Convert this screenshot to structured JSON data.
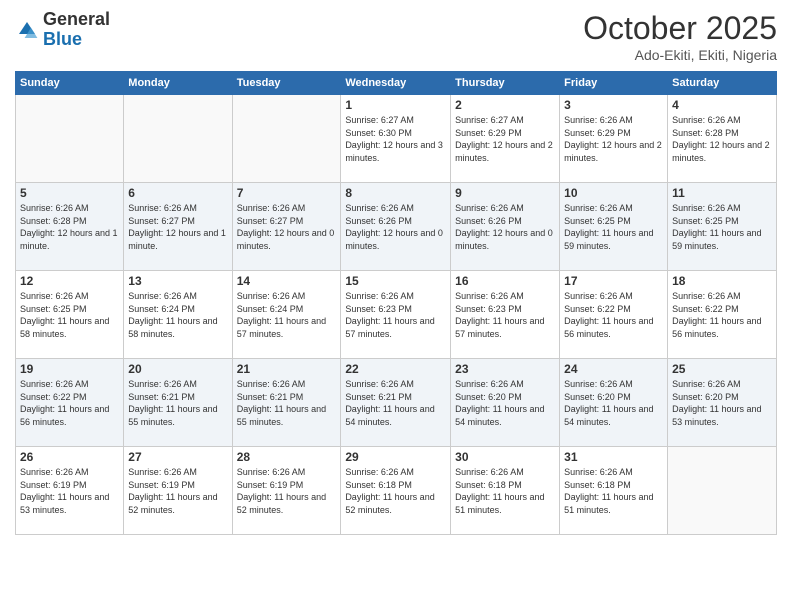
{
  "header": {
    "logo_general": "General",
    "logo_blue": "Blue",
    "month_title": "October 2025",
    "subtitle": "Ado-Ekiti, Ekiti, Nigeria"
  },
  "days_of_week": [
    "Sunday",
    "Monday",
    "Tuesday",
    "Wednesday",
    "Thursday",
    "Friday",
    "Saturday"
  ],
  "weeks": [
    [
      {
        "day": "",
        "sunrise": "",
        "sunset": "",
        "daylight": ""
      },
      {
        "day": "",
        "sunrise": "",
        "sunset": "",
        "daylight": ""
      },
      {
        "day": "",
        "sunrise": "",
        "sunset": "",
        "daylight": ""
      },
      {
        "day": "1",
        "sunrise": "Sunrise: 6:27 AM",
        "sunset": "Sunset: 6:30 PM",
        "daylight": "Daylight: 12 hours and 3 minutes."
      },
      {
        "day": "2",
        "sunrise": "Sunrise: 6:27 AM",
        "sunset": "Sunset: 6:29 PM",
        "daylight": "Daylight: 12 hours and 2 minutes."
      },
      {
        "day": "3",
        "sunrise": "Sunrise: 6:26 AM",
        "sunset": "Sunset: 6:29 PM",
        "daylight": "Daylight: 12 hours and 2 minutes."
      },
      {
        "day": "4",
        "sunrise": "Sunrise: 6:26 AM",
        "sunset": "Sunset: 6:28 PM",
        "daylight": "Daylight: 12 hours and 2 minutes."
      }
    ],
    [
      {
        "day": "5",
        "sunrise": "Sunrise: 6:26 AM",
        "sunset": "Sunset: 6:28 PM",
        "daylight": "Daylight: 12 hours and 1 minute."
      },
      {
        "day": "6",
        "sunrise": "Sunrise: 6:26 AM",
        "sunset": "Sunset: 6:27 PM",
        "daylight": "Daylight: 12 hours and 1 minute."
      },
      {
        "day": "7",
        "sunrise": "Sunrise: 6:26 AM",
        "sunset": "Sunset: 6:27 PM",
        "daylight": "Daylight: 12 hours and 0 minutes."
      },
      {
        "day": "8",
        "sunrise": "Sunrise: 6:26 AM",
        "sunset": "Sunset: 6:26 PM",
        "daylight": "Daylight: 12 hours and 0 minutes."
      },
      {
        "day": "9",
        "sunrise": "Sunrise: 6:26 AM",
        "sunset": "Sunset: 6:26 PM",
        "daylight": "Daylight: 12 hours and 0 minutes."
      },
      {
        "day": "10",
        "sunrise": "Sunrise: 6:26 AM",
        "sunset": "Sunset: 6:25 PM",
        "daylight": "Daylight: 11 hours and 59 minutes."
      },
      {
        "day": "11",
        "sunrise": "Sunrise: 6:26 AM",
        "sunset": "Sunset: 6:25 PM",
        "daylight": "Daylight: 11 hours and 59 minutes."
      }
    ],
    [
      {
        "day": "12",
        "sunrise": "Sunrise: 6:26 AM",
        "sunset": "Sunset: 6:25 PM",
        "daylight": "Daylight: 11 hours and 58 minutes."
      },
      {
        "day": "13",
        "sunrise": "Sunrise: 6:26 AM",
        "sunset": "Sunset: 6:24 PM",
        "daylight": "Daylight: 11 hours and 58 minutes."
      },
      {
        "day": "14",
        "sunrise": "Sunrise: 6:26 AM",
        "sunset": "Sunset: 6:24 PM",
        "daylight": "Daylight: 11 hours and 57 minutes."
      },
      {
        "day": "15",
        "sunrise": "Sunrise: 6:26 AM",
        "sunset": "Sunset: 6:23 PM",
        "daylight": "Daylight: 11 hours and 57 minutes."
      },
      {
        "day": "16",
        "sunrise": "Sunrise: 6:26 AM",
        "sunset": "Sunset: 6:23 PM",
        "daylight": "Daylight: 11 hours and 57 minutes."
      },
      {
        "day": "17",
        "sunrise": "Sunrise: 6:26 AM",
        "sunset": "Sunset: 6:22 PM",
        "daylight": "Daylight: 11 hours and 56 minutes."
      },
      {
        "day": "18",
        "sunrise": "Sunrise: 6:26 AM",
        "sunset": "Sunset: 6:22 PM",
        "daylight": "Daylight: 11 hours and 56 minutes."
      }
    ],
    [
      {
        "day": "19",
        "sunrise": "Sunrise: 6:26 AM",
        "sunset": "Sunset: 6:22 PM",
        "daylight": "Daylight: 11 hours and 56 minutes."
      },
      {
        "day": "20",
        "sunrise": "Sunrise: 6:26 AM",
        "sunset": "Sunset: 6:21 PM",
        "daylight": "Daylight: 11 hours and 55 minutes."
      },
      {
        "day": "21",
        "sunrise": "Sunrise: 6:26 AM",
        "sunset": "Sunset: 6:21 PM",
        "daylight": "Daylight: 11 hours and 55 minutes."
      },
      {
        "day": "22",
        "sunrise": "Sunrise: 6:26 AM",
        "sunset": "Sunset: 6:21 PM",
        "daylight": "Daylight: 11 hours and 54 minutes."
      },
      {
        "day": "23",
        "sunrise": "Sunrise: 6:26 AM",
        "sunset": "Sunset: 6:20 PM",
        "daylight": "Daylight: 11 hours and 54 minutes."
      },
      {
        "day": "24",
        "sunrise": "Sunrise: 6:26 AM",
        "sunset": "Sunset: 6:20 PM",
        "daylight": "Daylight: 11 hours and 54 minutes."
      },
      {
        "day": "25",
        "sunrise": "Sunrise: 6:26 AM",
        "sunset": "Sunset: 6:20 PM",
        "daylight": "Daylight: 11 hours and 53 minutes."
      }
    ],
    [
      {
        "day": "26",
        "sunrise": "Sunrise: 6:26 AM",
        "sunset": "Sunset: 6:19 PM",
        "daylight": "Daylight: 11 hours and 53 minutes."
      },
      {
        "day": "27",
        "sunrise": "Sunrise: 6:26 AM",
        "sunset": "Sunset: 6:19 PM",
        "daylight": "Daylight: 11 hours and 52 minutes."
      },
      {
        "day": "28",
        "sunrise": "Sunrise: 6:26 AM",
        "sunset": "Sunset: 6:19 PM",
        "daylight": "Daylight: 11 hours and 52 minutes."
      },
      {
        "day": "29",
        "sunrise": "Sunrise: 6:26 AM",
        "sunset": "Sunset: 6:18 PM",
        "daylight": "Daylight: 11 hours and 52 minutes."
      },
      {
        "day": "30",
        "sunrise": "Sunrise: 6:26 AM",
        "sunset": "Sunset: 6:18 PM",
        "daylight": "Daylight: 11 hours and 51 minutes."
      },
      {
        "day": "31",
        "sunrise": "Sunrise: 6:26 AM",
        "sunset": "Sunset: 6:18 PM",
        "daylight": "Daylight: 11 hours and 51 minutes."
      },
      {
        "day": "",
        "sunrise": "",
        "sunset": "",
        "daylight": ""
      }
    ]
  ]
}
